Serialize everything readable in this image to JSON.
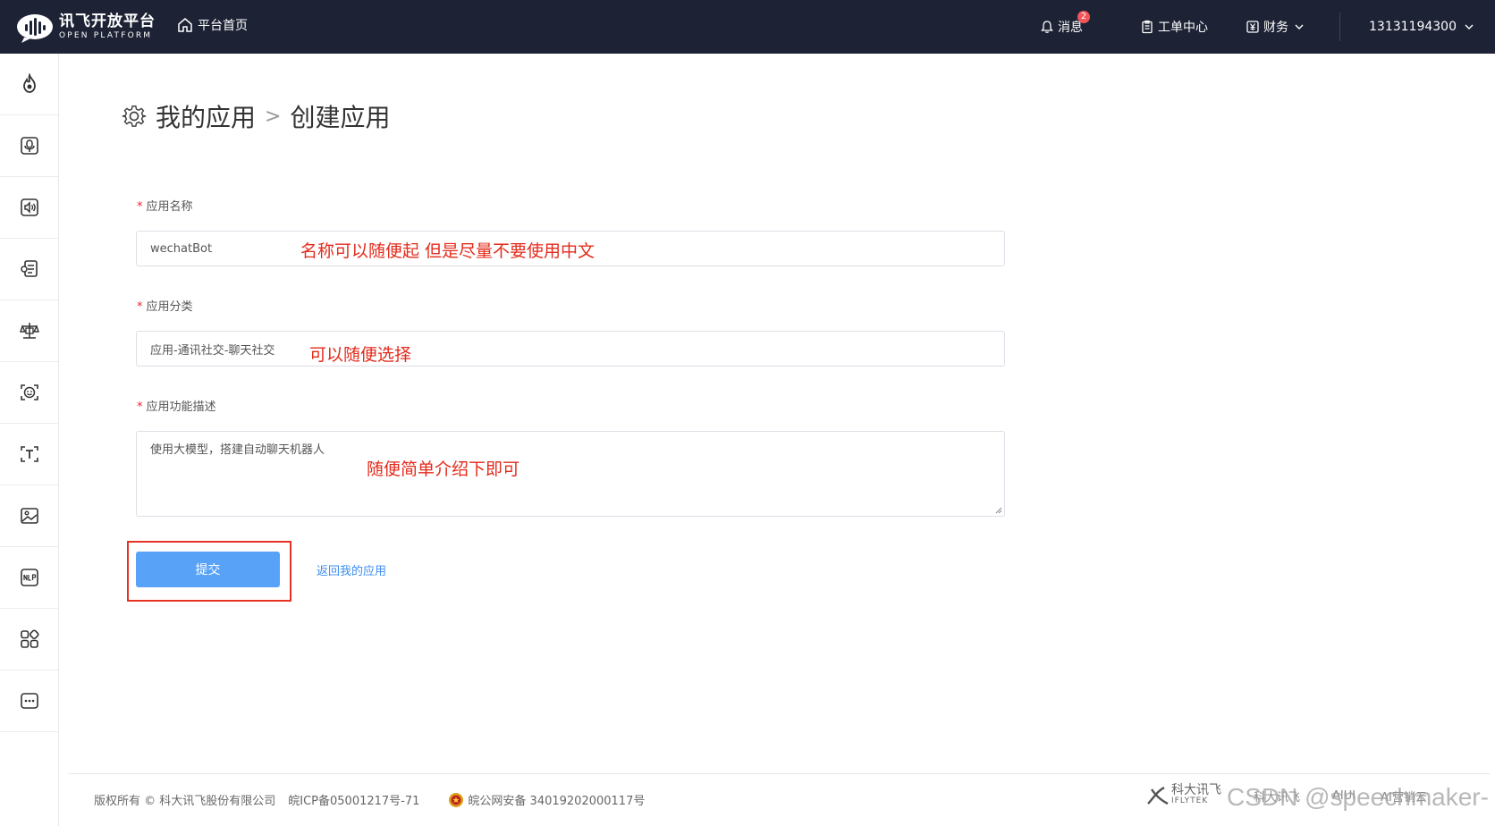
{
  "header": {
    "logo_title": "讯飞开放平台",
    "logo_subtitle": "OPEN PLATFORM",
    "home_label": "平台首页",
    "messages_label": "消息",
    "messages_badge": "2",
    "tickets_label": "工单中心",
    "finance_label": "财务",
    "account": "13131194300"
  },
  "sidebar": {
    "icons": [
      "flame-icon",
      "microphone-icon",
      "speaker-icon",
      "document-voice-icon",
      "scale-icon",
      "face-icon",
      "text-recognition-icon",
      "image-icon",
      "nlp-icon",
      "apps-grid-icon",
      "more-icon"
    ]
  },
  "breadcrumb": {
    "parent": "我的应用",
    "separator": ">",
    "current": "创建应用"
  },
  "form": {
    "name_label": "应用名称",
    "name_value": "wechatBot",
    "category_label": "应用分类",
    "category_value": "应用-通讯社交-聊天社交",
    "desc_label": "应用功能描述",
    "desc_value": "使用大模型，搭建自动聊天机器人",
    "required_mark": "*",
    "submit_label": "提交",
    "back_label": "返回我的应用"
  },
  "annotations": {
    "name_note": "名称可以随便起 但是尽量不要使用中文",
    "category_note": "可以随便选择",
    "desc_note": "随便简单介绍下即可"
  },
  "footer": {
    "copyright": "版权所有 © 科大讯飞股份有限公司",
    "icp": "皖ICP备05001217号-71",
    "police": "皖公网安备 34019202000117号",
    "brand": "科大讯飞",
    "brand_en": "IFLYTEK",
    "link1": "科大讯飞",
    "link2": "AIUI",
    "link3": "AI营销云"
  },
  "watermark": "CSDN @speechmaker-",
  "colors": {
    "topbar_bg": "#1d2235",
    "primary_button": "#58a2f7",
    "link": "#3b8cf0",
    "annotation_red": "#e42b1c"
  }
}
